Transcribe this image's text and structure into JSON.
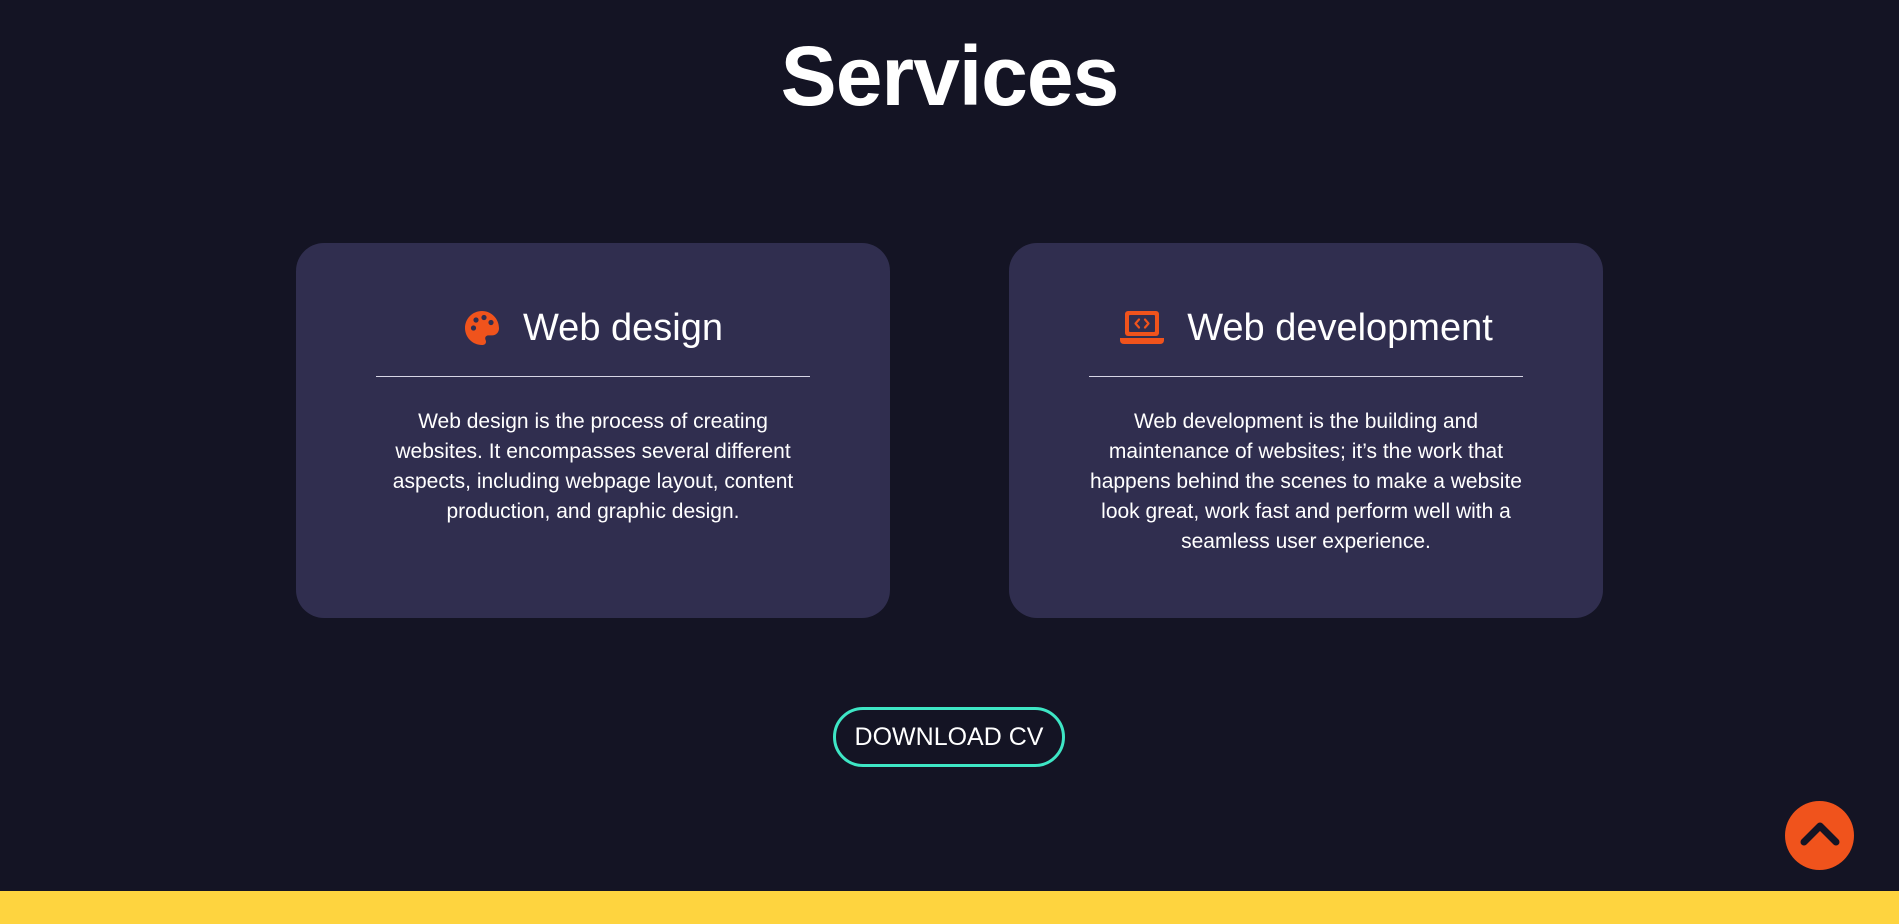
{
  "section": {
    "title": "Services"
  },
  "cards": [
    {
      "title": "Web design",
      "icon": "palette-icon",
      "description": "Web design is the process of creating websites. It encompasses several different aspects, including webpage layout, content production, and graphic design."
    },
    {
      "title": "Web development",
      "icon": "laptop-code-icon",
      "description": "Web development is the building and maintenance of websites; it’s the work that happens behind the scenes to make a website look great, work fast and perform well with a seamless user experience."
    }
  ],
  "cv_button": {
    "label": "DOWNLOAD CV"
  },
  "scroll_top": {
    "icon": "chevron-up-icon"
  },
  "colors": {
    "background": "#141424",
    "card": "#302e4f",
    "accent": "#f0531c",
    "button_border": "#3ee6c5",
    "footer": "#fed43f"
  }
}
